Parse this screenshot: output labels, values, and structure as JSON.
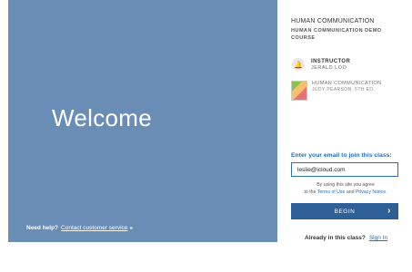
{
  "hero": {
    "title": "Welcome",
    "help_label": "Need help?",
    "help_link": "Contact customer service",
    "help_arrow": "▸"
  },
  "course": {
    "title": "HUMAN COMMUNICATION",
    "subtitle": "HUMAN COMMUNICATION DEMO COURSE"
  },
  "instructor": {
    "role": "INSTRUCTOR",
    "name": "JERALD LOO",
    "icon": "bell-icon"
  },
  "book": {
    "title": "HUMAN COMMUNICATION",
    "author": "JUDY PEARSON, 5TH ED."
  },
  "join": {
    "prompt": "Enter your email to join this class:",
    "email_value": "leslie@icloud.com",
    "agree_line1": "By using this site you agree",
    "agree_prefix": "to the",
    "terms_link": "Terms of Use",
    "and": "and",
    "privacy_link": "Privacy Notice.",
    "begin_label": "BEGIN",
    "begin_chevron": "›"
  },
  "footer": {
    "already_text": "Already in this class?",
    "sign_in": "Sign In"
  },
  "colors": {
    "hero_bg": "#6a8db6",
    "accent": "#2d6db5",
    "button_bg": "#2f5f97"
  }
}
